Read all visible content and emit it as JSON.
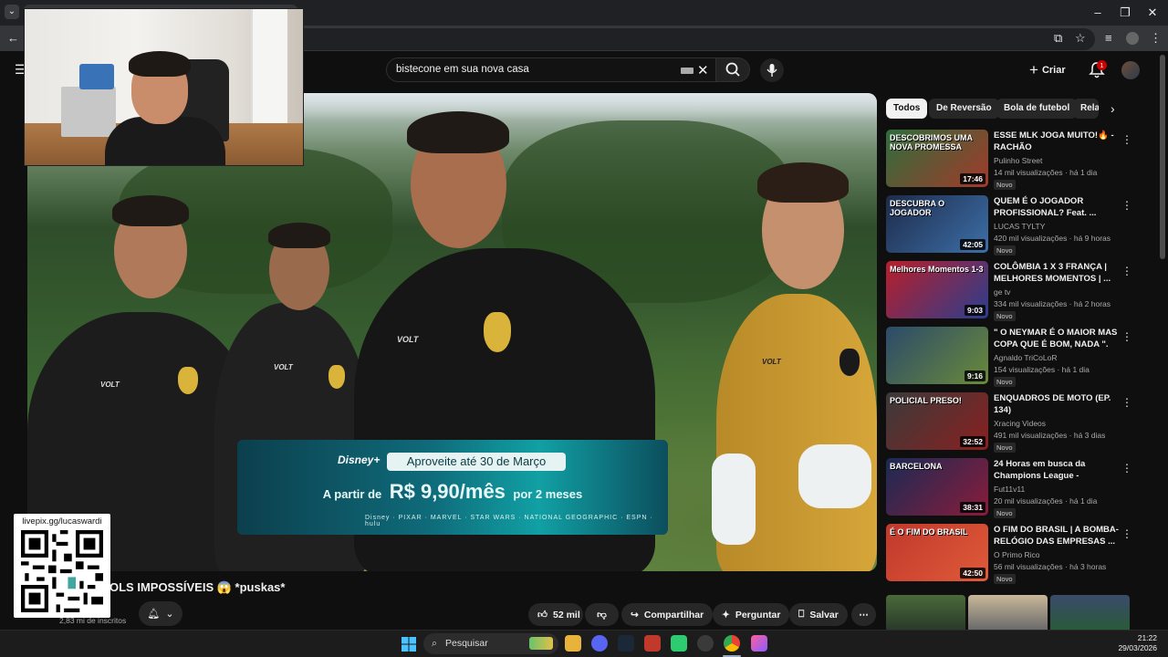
{
  "search": {
    "query": "bistecone em sua nova casa"
  },
  "header": {
    "create_label": "Criar",
    "notification_count": "1"
  },
  "ad": {
    "brand": "Disney+",
    "headline": "Aproveite até 30 de Março",
    "price_prefix": "A partir de",
    "price": "R$ 9,90/mês",
    "price_suffix": "por 2 meses",
    "partners": "Disney · PIXAR · MARVEL · STAR WARS · NATIONAL GEOGRAPHIC · ESPN · hulu"
  },
  "qr": {
    "label": "livepix.gg/lucaswardi"
  },
  "video": {
    "title": "GOLS IMPOSSÍVEIS 😱 *puskas*",
    "title_visible": "OLS IMPOSSÍVEIS 😱 *puskas*",
    "subscribers": "2,83 mi de inscritos",
    "likes": "52 mil",
    "share_label": "Compartilhar",
    "ask_label": "Perguntar",
    "save_label": "Salvar"
  },
  "chips": [
    "Todos",
    "De Reversão",
    "Bola de futebol",
    "Rela"
  ],
  "recommendations": [
    {
      "title": "ESSE MLK JOGA MUITO!🔥 - RACHÃO",
      "channel": "Pulinho Street",
      "meta": "14 mil visualizações · há 1 dia",
      "duration": "17:46",
      "badge": "Novo",
      "thumb_text": "DESCOBRIMOS UMA NOVA PROMESSA",
      "colors": [
        "#2e6d3c",
        "#a23a2a"
      ]
    },
    {
      "title": "QUEM É O JOGADOR PROFISSIONAL? Feat. ...",
      "channel": "LUCAS TYLTY",
      "meta": "420 mil visualizações · há 9 horas",
      "duration": "42:05",
      "badge": "Novo",
      "thumb_text": "DESCUBRA O JOGADOR",
      "colors": [
        "#1d2b4a",
        "#3d6fa8"
      ]
    },
    {
      "title": "COLÔMBIA 1 X 3 FRANÇA | MELHORES MOMENTOS | ...",
      "channel": "ge tv",
      "meta": "334 mil visualizações · há 2 horas",
      "duration": "9:03",
      "badge": "Novo",
      "thumb_text": "Melhores Momentos  1-3",
      "colors": [
        "#b81e2a",
        "#2a3e8f"
      ]
    },
    {
      "title": "\" O NEYMAR É O MAIOR MAS COPA QUE É BOM, NADA \". PV...",
      "channel": "Agnaldo TriCoLoR",
      "meta": "154 visualizações · há 1 dia",
      "duration": "9:16",
      "badge": "Novo",
      "thumb_text": "",
      "colors": [
        "#2b4a6a",
        "#6a8a3a"
      ]
    },
    {
      "title": "ENQUADROS DE MOTO (EP. 134)",
      "channel": "Xracing Videos",
      "meta": "491 mil visualizações · há 3 dias",
      "duration": "32:52",
      "badge": "Novo",
      "thumb_text": "POLICIAL PRESO!",
      "colors": [
        "#3a3a3a",
        "#8a2020"
      ]
    },
    {
      "title": "24 Horas em busca da Champions League - Barcelon...",
      "channel": "Fut11v11",
      "meta": "20 mil visualizações · há 1 dia",
      "duration": "38:31",
      "badge": "Novo",
      "thumb_text": "BARCELONA",
      "colors": [
        "#1a2a55",
        "#8a1c3a"
      ]
    },
    {
      "title": "O FIM DO BRASIL | A BOMBA-RELÓGIO DAS EMPRESAS ...",
      "channel": "O Primo Rico",
      "meta": "56 mil visualizações · há 3 horas",
      "duration": "42:50",
      "badge": "Novo",
      "thumb_text": "É O FIM DO BRASIL",
      "colors": [
        "#c0392b",
        "#e05a3a"
      ]
    }
  ],
  "taskbar": {
    "search_label": "Pesquisar",
    "time": "21:22",
    "date": "29/03/2026"
  }
}
